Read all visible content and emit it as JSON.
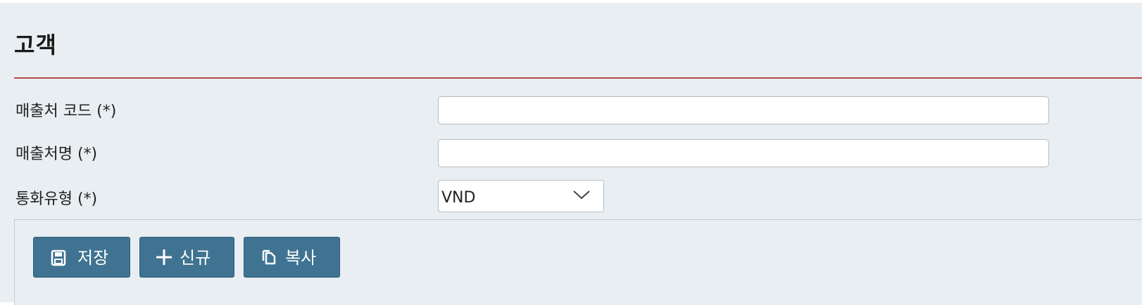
{
  "page": {
    "title": "고객"
  },
  "form": {
    "customer_code": {
      "label": "매출처 코드 (*)",
      "value": "",
      "placeholder": ""
    },
    "customer_name": {
      "label": "매출처명 (*)",
      "value": "",
      "placeholder": ""
    },
    "currency_type": {
      "label": "통화유형 (*)",
      "selected": "VND"
    }
  },
  "toolbar": {
    "save": {
      "label": "저장",
      "icon": "save-icon"
    },
    "new": {
      "label": "신규",
      "icon": "plus-icon"
    },
    "copy": {
      "label": "복사",
      "icon": "copy-icon"
    }
  },
  "colors": {
    "panel_bg": "#e8eef1",
    "divider": "#b94a48",
    "button_bg": "#3f7391"
  }
}
